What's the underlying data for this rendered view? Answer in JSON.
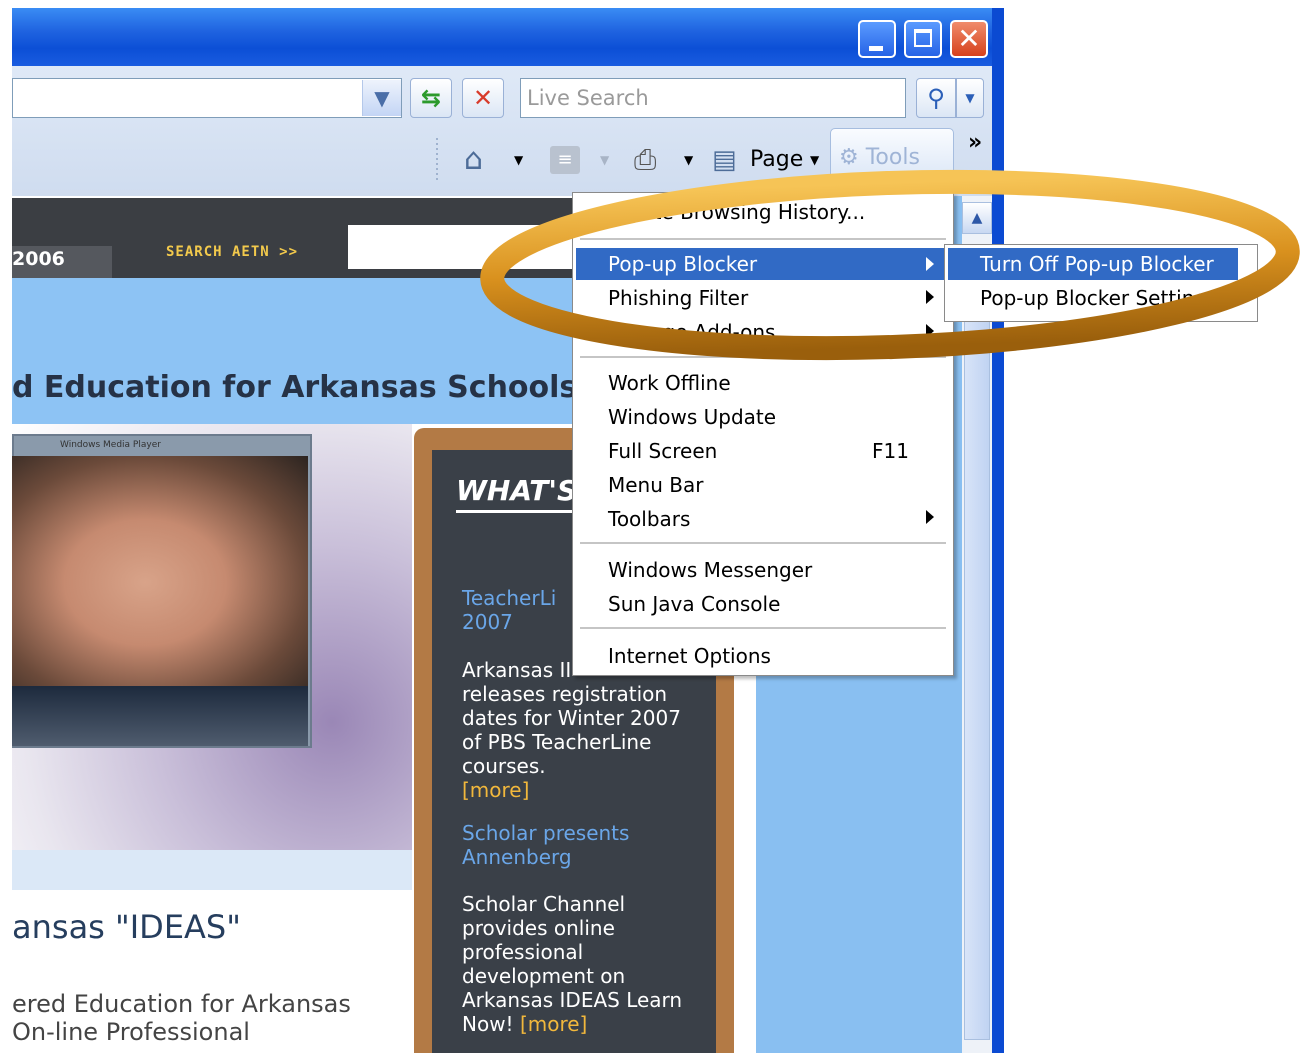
{
  "window": {
    "close_glyph": "✕"
  },
  "toolbar": {
    "refresh_glyph": "⇆",
    "stop_glyph": "✕",
    "search_placeholder": "Live Search",
    "search_go_glyph": "⚲",
    "home_glyph": "⌂",
    "feeds_glyph": "≡",
    "print_glyph": "⎙",
    "page_icon_glyph": "▤",
    "page_label": "Page",
    "tools_label": "Tools",
    "chevron": "»",
    "dropdown_glyph": "▼"
  },
  "page": {
    "year": "2006",
    "search_aetn": "SEARCH AETN >>",
    "headline": "d Education for Arkansas Schools",
    "wmp_title": "Windows Media Player",
    "ideas_title": "ansas \"IDEAS\"",
    "para_line1": "ered Education for Arkansas",
    "para_line2": "On-line Professional",
    "whats": "WHAT'S",
    "news1_title_l1": "TeacherLi",
    "news1_title_l2": "2007",
    "news1_body": [
      "Arkansas II",
      "releases registration",
      "dates for Winter 2007",
      "of PBS TeacherLine",
      "courses."
    ],
    "more": "[more]",
    "news2_title_l1": "Scholar presents",
    "news2_title_l2": "Annenberg",
    "news2_body": [
      "Scholar Channel",
      "provides online",
      "professional",
      "development on",
      "Arkansas IDEAS Learn",
      "Now!"
    ]
  },
  "tools_menu": {
    "delete_history": "Delete Browsing History...",
    "popup_blocker": "Pop-up Blocker",
    "phishing_filter": "Phishing Filter",
    "manage_addons": "Manage Add-ons",
    "work_offline": "Work Offline",
    "windows_update": "Windows Update",
    "full_screen": "Full Screen",
    "full_screen_key": "F11",
    "menu_bar": "Menu Bar",
    "toolbars": "Toolbars",
    "windows_messenger": "Windows Messenger",
    "sun_java": "Sun Java Console",
    "internet_options": "Internet Options"
  },
  "popup_submenu": {
    "turn_off": "Turn Off Pop-up Blocker",
    "settings": "Pop-up Blocker Settings"
  },
  "colors": {
    "highlight": "#316ac5",
    "ring": "#d9911e",
    "title_blue": "#0c4fd6"
  }
}
